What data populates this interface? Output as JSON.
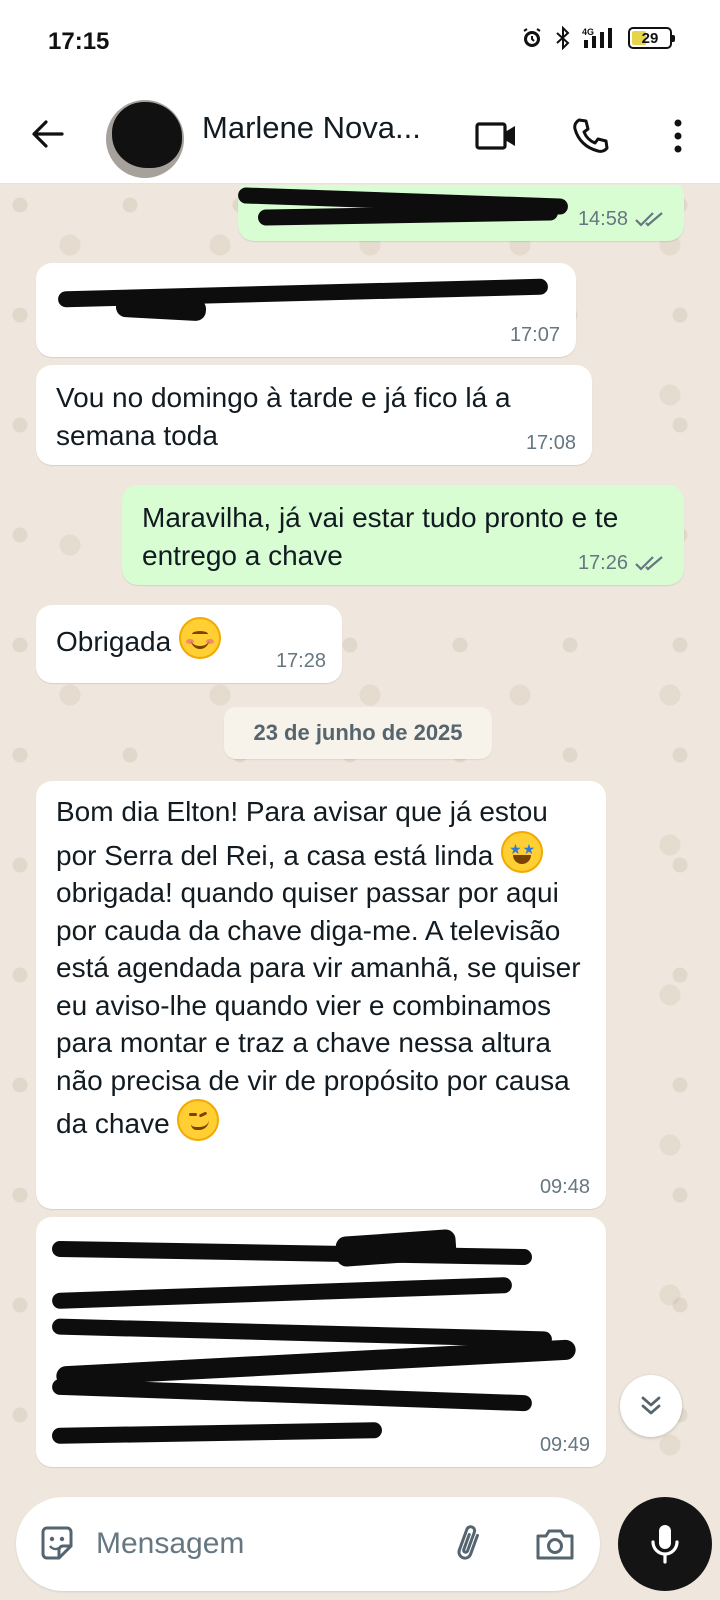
{
  "status_bar": {
    "time": "17:15",
    "battery": "29",
    "network": "4G"
  },
  "header": {
    "contact_name": "Marlene Nova..."
  },
  "messages": [
    {
      "direction": "out",
      "text": "",
      "time": "14:58",
      "redacted": true
    },
    {
      "direction": "in",
      "text": "",
      "time": "17:07",
      "redacted": true
    },
    {
      "direction": "in",
      "text": "Vou no domingo à tarde e já fico lá a semana toda",
      "time": "17:08"
    },
    {
      "direction": "out",
      "text": "Maravilha, já vai estar tudo pronto e te entrego a chave",
      "time": "17:26"
    },
    {
      "direction": "in",
      "text": "Obrigada",
      "emoji": "smiling-face-icon",
      "time": "17:28"
    },
    {
      "direction": "in",
      "text_part1": "Bom dia Elton! Para avisar que já estou por Serra del Rei, a casa está linda",
      "emoji_1": "star-struck-icon",
      "text_part2": "obrigada! quando quiser passar por aqui por cauda da chave diga-me. A televisão está agendada para vir amanhã, se quiser eu aviso-lhe quando vier e combinamos para montar e traz a chave nessa altura não precisa de vir de propósito por causa da chave",
      "emoji_2": "winking-face-icon",
      "time": "09:48"
    },
    {
      "direction": "in",
      "text": "",
      "time": "09:49",
      "redacted": true
    }
  ],
  "date_separator": "23 de junho de 2025",
  "composer": {
    "placeholder": "Mensagem"
  },
  "colors": {
    "incoming": "#ffffff",
    "outgoing": "#d9fdd3",
    "background": "#efe7dd",
    "mic_button": "#141414"
  }
}
